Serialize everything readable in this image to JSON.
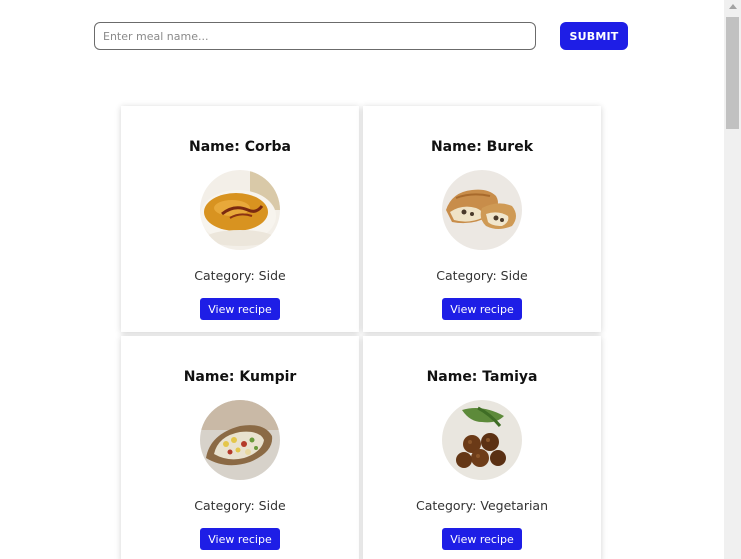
{
  "search": {
    "placeholder": "Enter meal name...",
    "value": ""
  },
  "submit_label": "SUBMIT",
  "meals": [
    {
      "name": "Name: Corba",
      "category": "Category: Side",
      "button": "View recipe",
      "image": "soup-bowl"
    },
    {
      "name": "Name: Burek",
      "category": "Category: Side",
      "button": "View recipe",
      "image": "pastry"
    },
    {
      "name": "Name: Kumpir",
      "category": "Category: Side",
      "button": "View recipe",
      "image": "stuffed-potato"
    },
    {
      "name": "Name: Tamiya",
      "category": "Category: Vegetarian",
      "button": "View recipe",
      "image": "falafel"
    }
  ],
  "colors": {
    "accent": "#1e1ee6"
  }
}
